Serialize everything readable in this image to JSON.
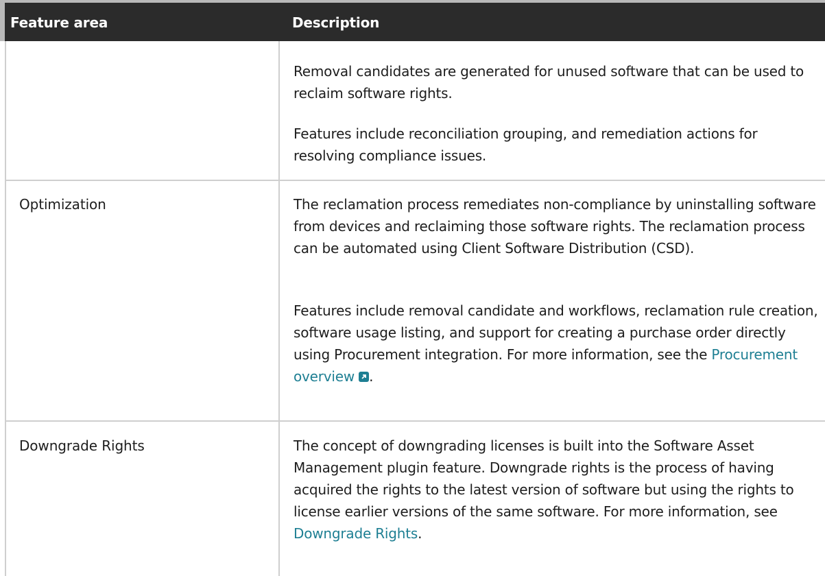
{
  "header": {
    "col_feature": "Feature area",
    "col_description": "Description"
  },
  "rows": [
    {
      "feature": "",
      "paragraphs": [
        "Removal candidates are generated for unused software that can be used to reclaim software rights.",
        "Features include reconciliation grouping, and remediation actions for resolving compliance issues."
      ]
    },
    {
      "feature": "Optimization",
      "paragraphs": [
        "The reclamation process remediates non-compliance by uninstalling software from devices and reclaiming those software rights. The reclamation process can be automated using Client Software Distribution (CSD).",
        "Features include removal candidate and workflows, reclamation rule creation, software usage listing, and support for creating a purchase order directly using Procurement integration. For more information, see the"
      ],
      "link_text": "Procurement overview",
      "link_suffix": ".",
      "link_icon": "external-link-icon"
    },
    {
      "feature": "Downgrade Rights",
      "paragraphs": [
        "The concept of downgrading licenses is built into the Software Asset Management plugin feature. Downgrade rights is the process of having acquired the rights to the latest version of software but using the rights to license earlier versions of the same software. For more information, see"
      ],
      "link_text": "Downgrade Rights",
      "link_suffix": "."
    }
  ],
  "colors": {
    "header_bg": "#2b2b2b",
    "link": "#1e7f93",
    "border": "#cfcfcf"
  }
}
